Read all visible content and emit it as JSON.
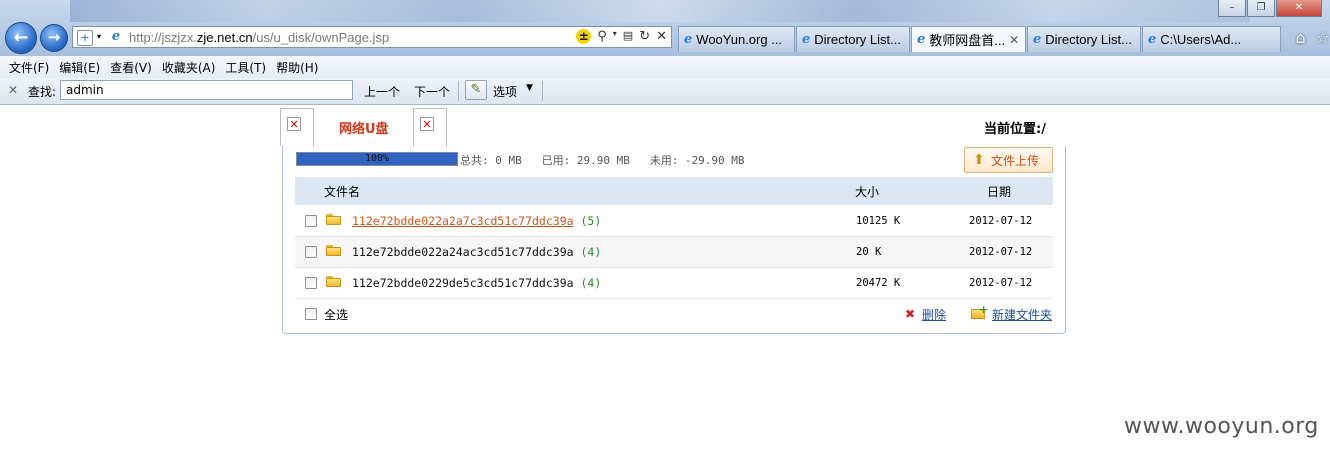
{
  "browser": {
    "address": {
      "url_prefix": "http://jszjzx.",
      "url_domain": "zje.net.cn",
      "url_path": "/us/u_disk/ownPage.jsp"
    },
    "tabs": [
      {
        "title": "WooYun.org ..."
      },
      {
        "title": "Directory List..."
      },
      {
        "title": "教师网盘首..."
      },
      {
        "title": "Directory List..."
      },
      {
        "title": "C:\\Users\\Ad..."
      }
    ],
    "menu": [
      "文件(F)",
      "编辑(E)",
      "查看(V)",
      "收藏夹(A)",
      "工具(T)",
      "帮助(H)"
    ],
    "find": {
      "label": "查找:",
      "value": "admin",
      "prev": "上一个",
      "next": "下一个",
      "options": "选项"
    }
  },
  "page": {
    "tab_label": "网络U盘",
    "current_location": "当前位置:/",
    "usage": {
      "percent_label": "100%",
      "fill_fraction": 1.0,
      "stats": "总共: 0 MB   已用: 29.90 MB   未用: -29.90 MB"
    },
    "upload_label": "文件上传",
    "columns": {
      "name": "文件名",
      "size": "大小",
      "date": "日期"
    },
    "files": [
      {
        "name": "112e72bdde022a2a7c3cd51c77ddc39a",
        "count": "(5)",
        "size": "10125 K",
        "date": "2012-07-12",
        "link": true
      },
      {
        "name": "112e72bdde022a24ac3cd51c77ddc39a",
        "count": "(4)",
        "size": "20 K",
        "date": "2012-07-12",
        "link": false
      },
      {
        "name": "112e72bdde0229de5c3cd51c77ddc39a",
        "count": "(4)",
        "size": "20472 K",
        "date": "2012-07-12",
        "link": false
      }
    ],
    "select_all": "全选",
    "delete_label": "删除",
    "new_folder_label": "新建文件夹"
  },
  "watermark": "www.wooyun.org"
}
